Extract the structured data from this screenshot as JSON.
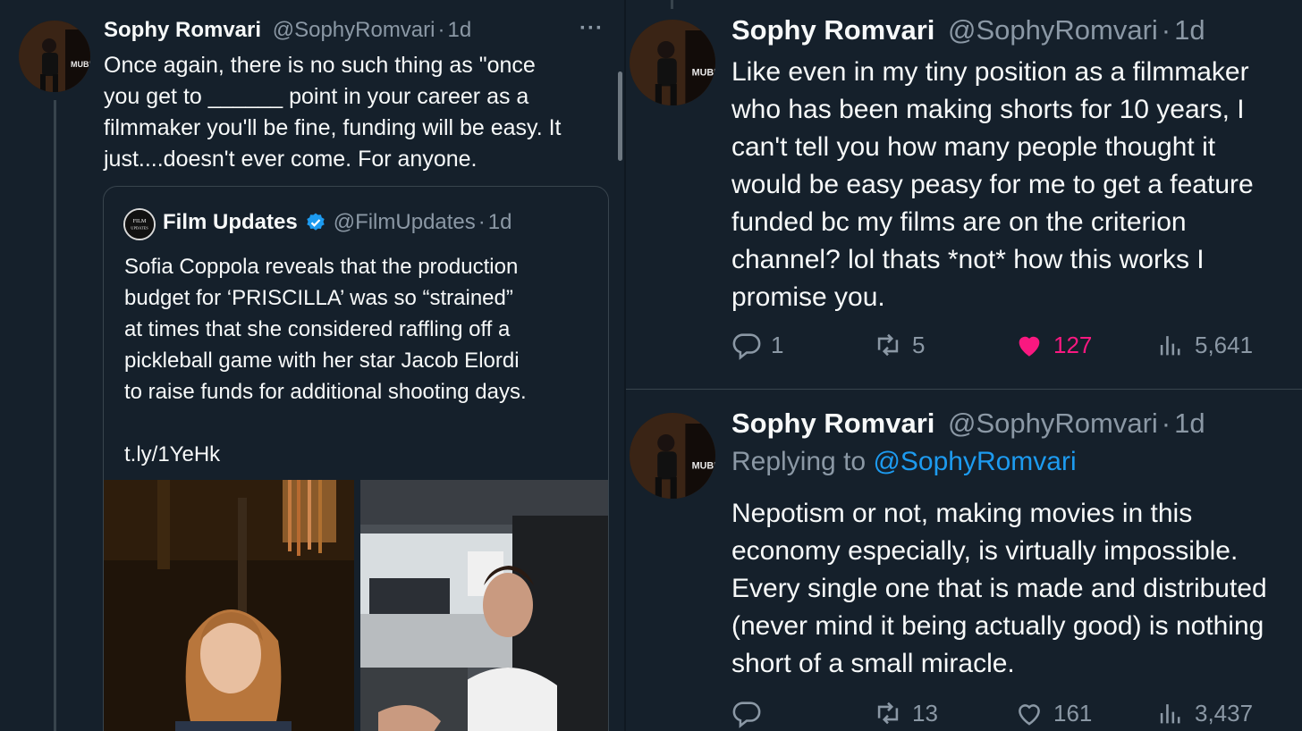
{
  "left_tweet": {
    "author_name": "Sophy Romvari",
    "handle": "@SophyRomvari",
    "sep": "·",
    "time": "1d",
    "more_label": "···",
    "avatar_text": "MUBI",
    "body_lines": [
      "Once again, there is no such thing as \"once",
      "you get to ______ point in your career as a",
      "filmmaker you'll be fine, funding will be easy. It",
      "just....doesn't ever come. For anyone."
    ],
    "quote": {
      "author_name": "Film Updates",
      "handle": "@FilmUpdates",
      "sep": "·",
      "time": "1d",
      "avatar_text_1": "FILM",
      "avatar_text_2": "UPDATES",
      "verified_icon": "verified-badge-icon",
      "body_lines": [
        "Sofia Coppola reveals that the production",
        "budget for ‘PRISCILLA’ was so “strained”",
        "at times that she considered raffling off a",
        "pickleball game with her star Jacob Elordi",
        "to raise funds for additional shooting days."
      ],
      "link": "t.ly/1YeHk"
    }
  },
  "right_tweets": [
    {
      "author_name": "Sophy Romvari",
      "handle": "@SophyRomvari",
      "sep": "·",
      "time": "1d",
      "avatar_text": "MUBI",
      "body_lines": [
        "Like even in my tiny position as a filmmaker",
        "who has been making shorts for 10 years, I",
        "can't tell you how many people thought it",
        "would be easy peasy for me to get a feature",
        "funded bc my films are on the criterion",
        "channel? lol thats *not* how this works I",
        "promise you."
      ],
      "actions": {
        "replies": "1",
        "reposts": "5",
        "likes": "127",
        "views": "5,641"
      },
      "liked": true
    },
    {
      "author_name": "Sophy Romvari",
      "handle": "@SophyRomvari",
      "sep": "·",
      "time": "1d",
      "avatar_text": "MUBI",
      "replying_prefix": "Replying to",
      "replying_to": "@SophyRomvari",
      "body_lines": [
        "Nepotism or not, making movies in this",
        "economy especially, is virtually impossible.",
        "Every single one that is made and distributed",
        "(never mind it being actually good) is nothing",
        "short of a small miracle."
      ],
      "actions": {
        "replies": "",
        "reposts": "13",
        "likes": "161",
        "views": "3,437"
      },
      "liked": false
    }
  ],
  "colors": {
    "background": "#15202b",
    "text": "#f7f9f9",
    "muted": "#8b98a5",
    "link": "#1d9bf0",
    "like": "#f91880",
    "border": "#38444d"
  }
}
